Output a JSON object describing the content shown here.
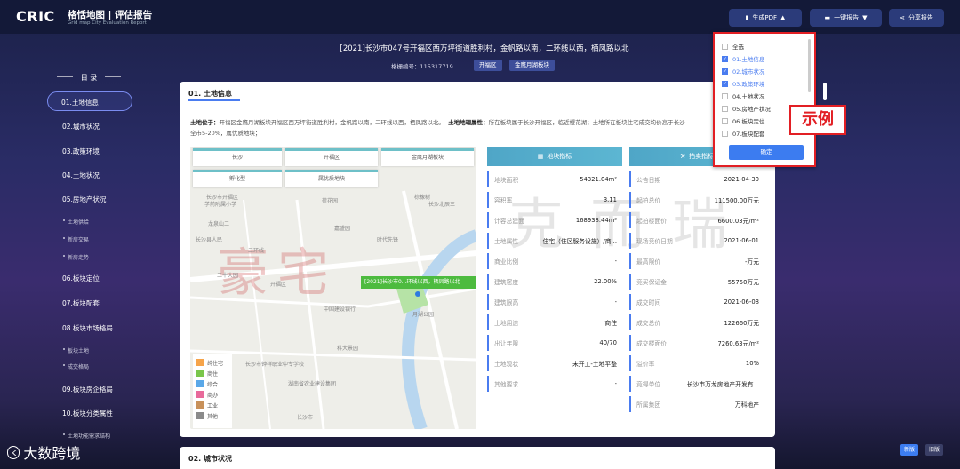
{
  "header": {
    "logo": "CRIC",
    "title": "格恬地图 | 评估报告",
    "subtitle": "Grid map City Evaluation Report",
    "pdf_btn": "生成PDF",
    "report_btn": "一键报告",
    "share_btn": "分享报告"
  },
  "page": {
    "title": "[2021]长沙市047号开福区西万坪街道胜利村，金帆路以南，二环线以西，栖凤路以北",
    "code": "格栅编号：115317719",
    "tags": [
      "开福区",
      "金鹰月湖板块"
    ]
  },
  "toc": {
    "heading": "目 录",
    "items": [
      "01.土地信息",
      "02.城市状况",
      "03.政策环境",
      "04.土地状况",
      "05.房地产状况",
      "06.板块定位",
      "07.板块配套",
      "08.板块市场格局",
      "09.板块房企格局",
      "10.板块分类属性"
    ],
    "sub5": [
      "土地供给",
      "新房交易",
      "新房走势"
    ],
    "sub8": [
      "板块土地",
      "成交格局"
    ],
    "sub10": [
      "土地功能需求结构"
    ]
  },
  "section1": {
    "title": "01. 土地信息",
    "loc_label": "土地位于：",
    "loc_text": "开福区金鹰月湖板块开福区西万坪街道胜利村，金帆路以南，二环线以西，栖凤路以北。",
    "attr_label": "土地地理属性：",
    "attr_text": "所在板块属于长沙开福区，临近樱花湖；土地所在板块住宅成交均价高于长沙",
    "line2": "全市5-20%，属优质地块；",
    "map_tabs": [
      "长沙",
      "开福区",
      "金鹰月湖板块",
      "孵化型",
      "属优质地块"
    ],
    "map_labels": [
      "长沙市开福区",
      "学前附属小学",
      "龙泉山二",
      "长沙县人民",
      "二环线",
      "二十大园",
      "开福区",
      "中国建设银行",
      "嘉盛园",
      "荷花园",
      "长沙北辰三",
      "棕橡树",
      "时代先锋",
      "月湖公园",
      "科大景园",
      "长沙市钟祥职业中专学校",
      "湖南省农业建设集团",
      "长沙市"
    ],
    "poi": "[2021]长沙市0...环线以西，栖凤路以北",
    "legend": [
      {
        "label": "纯住宅",
        "color": "#f6a44a"
      },
      {
        "label": "商住",
        "color": "#7ac64a"
      },
      {
        "label": "综合",
        "color": "#5aa8e8"
      },
      {
        "label": "商办",
        "color": "#e86a9a"
      },
      {
        "label": "工业",
        "color": "#c8915a"
      },
      {
        "label": "其他",
        "color": "#8a8a8a"
      }
    ],
    "indicators_title": "地块指标",
    "indicators": [
      {
        "k": "地块面积",
        "v": "54321.04m²"
      },
      {
        "k": "容积率",
        "v": "3.11"
      },
      {
        "k": "计容总建面",
        "v": "168938.44m²"
      },
      {
        "k": "土地属性",
        "v": "住宅（住区服务设施）/商..."
      },
      {
        "k": "商业比例",
        "v": "-"
      },
      {
        "k": "建筑密度",
        "v": "22.00%"
      },
      {
        "k": "建筑限高",
        "v": "-"
      },
      {
        "k": "土地用途",
        "v": "商住"
      },
      {
        "k": "出让年限",
        "v": "40/70"
      },
      {
        "k": "土地现状",
        "v": "未开工-土地平整"
      },
      {
        "k": "其他要求",
        "v": "-"
      }
    ],
    "trade_title": "拍卖指标",
    "trade": [
      {
        "k": "公告日期",
        "v": "2021-04-30"
      },
      {
        "k": "起拍总价",
        "v": "111500.00万元"
      },
      {
        "k": "起拍楼面价",
        "v": "6600.03元/m²"
      },
      {
        "k": "现场竞价日期",
        "v": "2021-06-01"
      },
      {
        "k": "最高限价",
        "v": "-万元"
      },
      {
        "k": "竞买保证金",
        "v": "55750万元"
      },
      {
        "k": "成交时间",
        "v": "2021-06-08"
      },
      {
        "k": "成交总价",
        "v": "122660万元"
      },
      {
        "k": "成交楼面价",
        "v": "7260.63元/m²"
      },
      {
        "k": "溢价率",
        "v": "10%"
      },
      {
        "k": "竞得单位",
        "v": "长沙市万龙房地产开发有..."
      },
      {
        "k": "所属集团",
        "v": "万科地产"
      }
    ]
  },
  "section2": {
    "title": "02. 城市状况"
  },
  "dropdown": {
    "items": [
      {
        "label": "全选",
        "checked": false
      },
      {
        "label": "01.土地信息",
        "checked": true
      },
      {
        "label": "02.城市状况",
        "checked": true
      },
      {
        "label": "03.政策环境",
        "checked": true
      },
      {
        "label": "04.土地状况",
        "checked": false
      },
      {
        "label": "05.房地产状况",
        "checked": false
      },
      {
        "label": "06.板块定位",
        "checked": false
      },
      {
        "label": "07.板块配套",
        "checked": false
      }
    ],
    "confirm": "确定"
  },
  "sample_label": "示例",
  "watermark": {
    "w1": "豪宅",
    "w2": "克而瑞"
  },
  "bottom": {
    "brand": "大数跨境",
    "brand_icon": "k",
    "ver_new": "新版",
    "ver_old": "旧版"
  }
}
